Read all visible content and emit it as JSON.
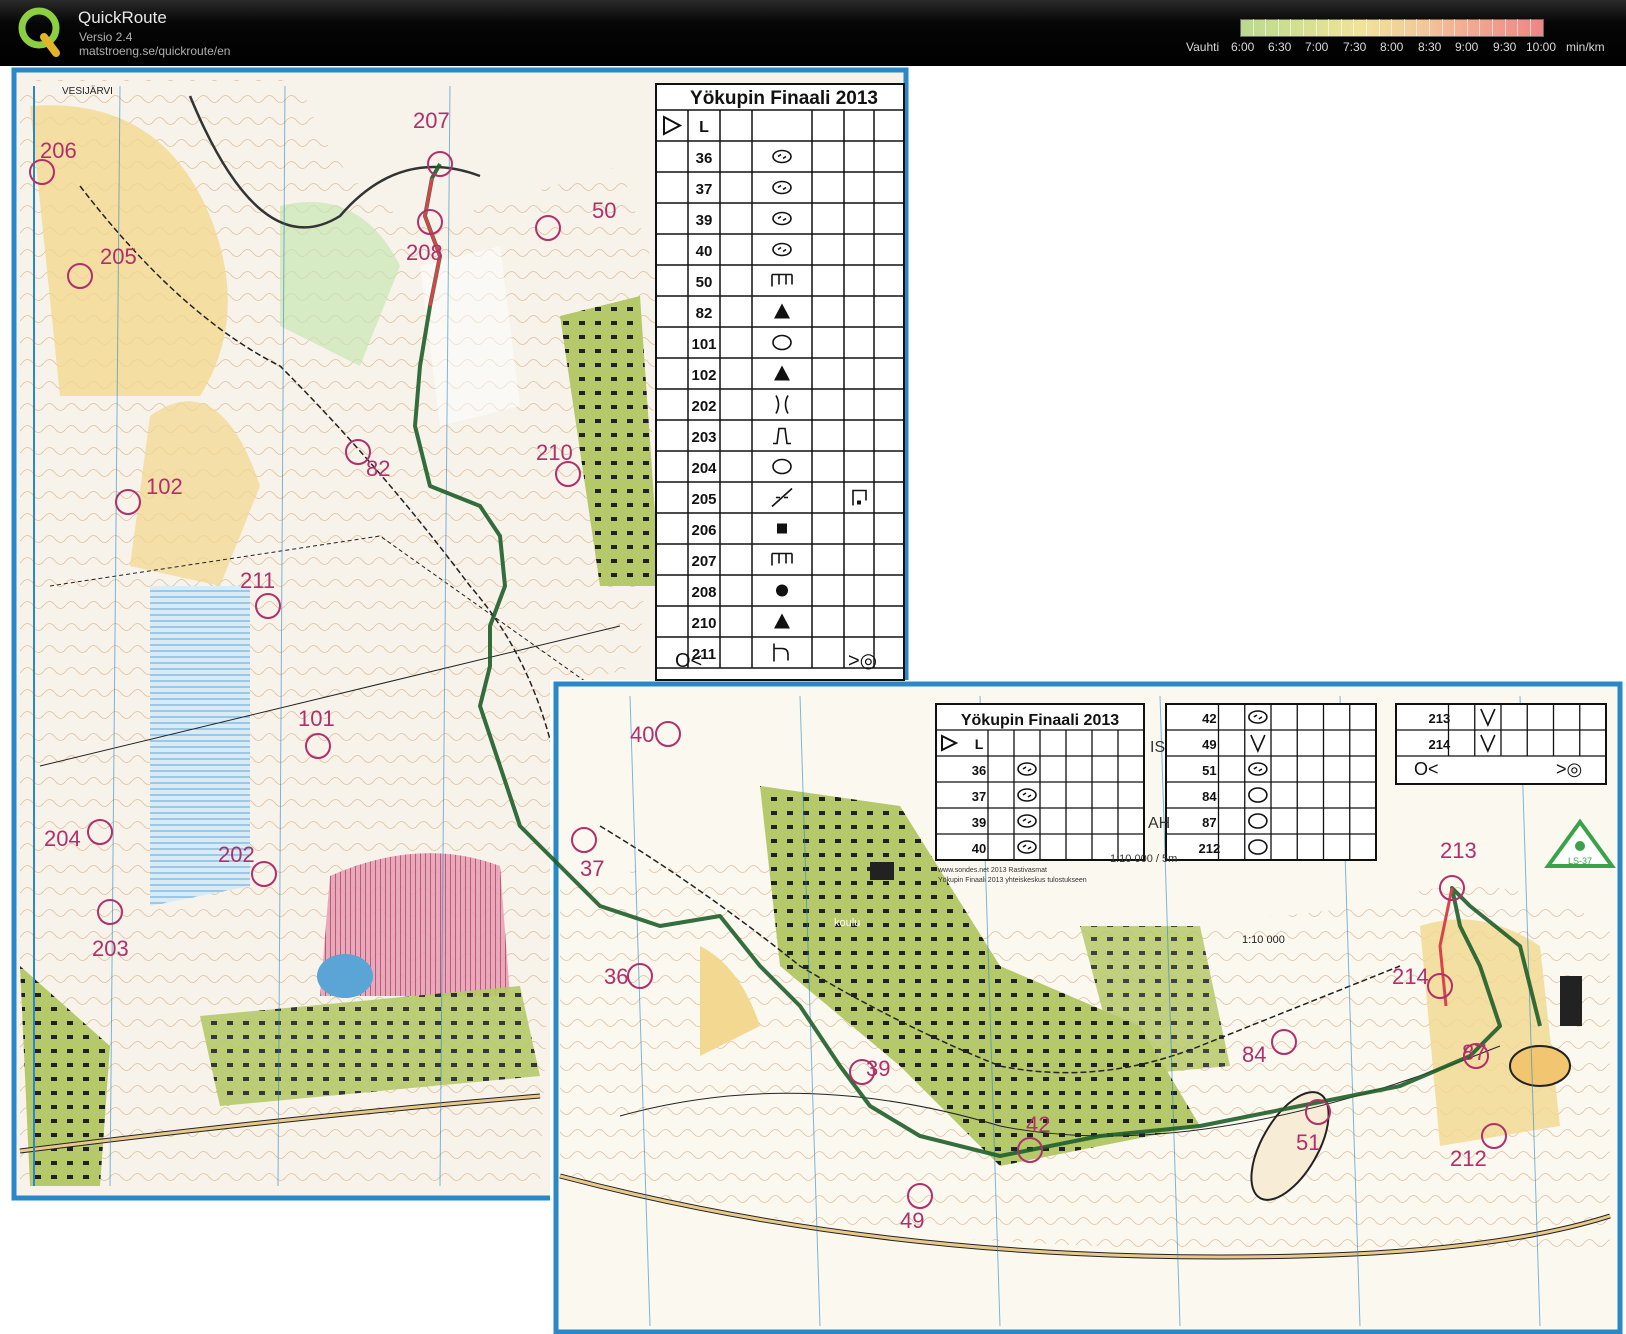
{
  "app": {
    "name": "QuickRoute",
    "version": "Versio 2.4",
    "url": "matstroeng.se/quickroute/en"
  },
  "pace_legend": {
    "label": "Vauhti",
    "ticks": [
      "6:00",
      "6:30",
      "7:00",
      "7:30",
      "8:00",
      "8:30",
      "9:00",
      "9:30",
      "10:00"
    ],
    "unit": "min/km",
    "colors": [
      "#b9d98e",
      "#f1e39a",
      "#ee8686"
    ]
  },
  "map": {
    "top_place_label": "VESIJÄRVI",
    "school_label": "koulu",
    "scale_label": "1:10 000",
    "scale_label_small": "1:10 000",
    "area_label": "LS-37",
    "controls_sheet1": [
      "207",
      "206",
      "205",
      "208",
      "50",
      "102",
      "82",
      "210",
      "211",
      "101",
      "204",
      "202",
      "203",
      "40",
      "37",
      "36"
    ],
    "controls_sheet2": [
      "213",
      "214",
      "39",
      "84",
      "87",
      "42",
      "51",
      "212",
      "49"
    ]
  },
  "description_sheet_1": {
    "title": "Yökupin Finaali 2013",
    "header_code": "L",
    "rows": [
      {
        "code": "36",
        "symbol": "saddle"
      },
      {
        "code": "37",
        "symbol": "saddle"
      },
      {
        "code": "39",
        "symbol": "saddle"
      },
      {
        "code": "40",
        "symbol": "saddle"
      },
      {
        "code": "50",
        "symbol": "ruined-wall"
      },
      {
        "code": "82",
        "symbol": "triangle"
      },
      {
        "code": "101",
        "symbol": "ellipse"
      },
      {
        "code": "102",
        "symbol": "triangle"
      },
      {
        "code": "202",
        "symbol": "re-entrant"
      },
      {
        "code": "203",
        "symbol": "knoll"
      },
      {
        "code": "204",
        "symbol": "ellipse"
      },
      {
        "code": "205",
        "symbol": "path-crossing",
        "extra": "corner"
      },
      {
        "code": "206",
        "symbol": "square"
      },
      {
        "code": "207",
        "symbol": "ruined-wall"
      },
      {
        "code": "208",
        "symbol": "dot"
      },
      {
        "code": "210",
        "symbol": "triangle"
      },
      {
        "code": "211",
        "symbol": "junction"
      }
    ],
    "footer_start": "O<",
    "footer_finish": ">◎"
  },
  "description_sheet_2": {
    "title": "Yökupin Finaali 2013",
    "header_code": "L",
    "col1": [
      {
        "code": "36",
        "symbol": "saddle"
      },
      {
        "code": "37",
        "symbol": "saddle"
      },
      {
        "code": "39",
        "symbol": "saddle"
      },
      {
        "code": "40",
        "symbol": "saddle"
      }
    ],
    "col2": [
      {
        "code": "42",
        "symbol": "saddle"
      },
      {
        "code": "49",
        "symbol": "v"
      },
      {
        "code": "51",
        "symbol": "saddle"
      },
      {
        "code": "84",
        "symbol": "ellipse"
      },
      {
        "code": "87",
        "symbol": "ellipse"
      },
      {
        "code": "212",
        "symbol": "ellipse"
      }
    ],
    "col3": [
      {
        "code": "213",
        "symbol": "v"
      },
      {
        "code": "214",
        "symbol": "v"
      }
    ],
    "footer_start": "O<",
    "footer_finish": ">◎",
    "fragments": [
      "IS",
      "AH",
      "1:10 000   /   5m"
    ],
    "fine_print_1": "www.sondes.net 2013 Rastivasmat",
    "fine_print_2": "Yökupin Finaali 2013 yhteiskeskus tulostukseen"
  }
}
